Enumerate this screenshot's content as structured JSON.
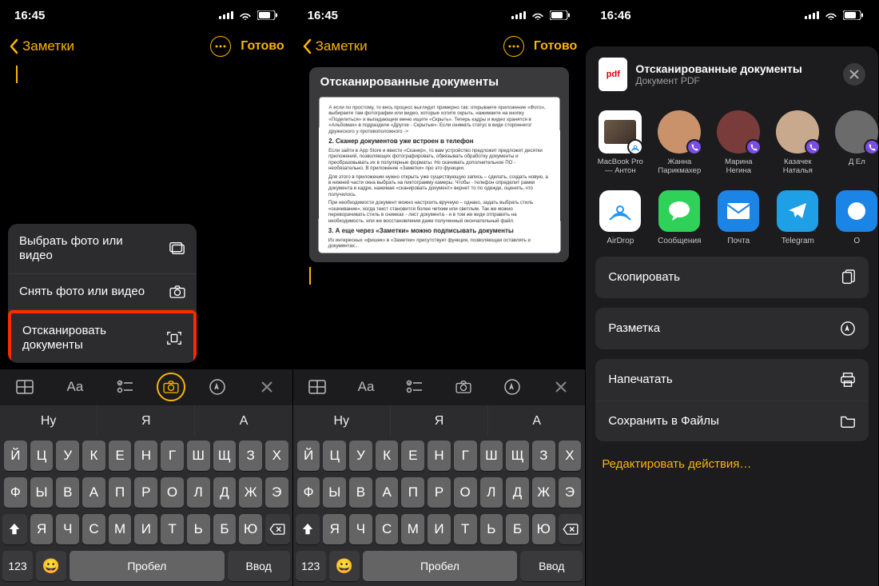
{
  "screen1": {
    "time": "16:45",
    "back": "Заметки",
    "done": "Готово",
    "menu": {
      "choose": "Выбрать фото или видео",
      "take": "Снять фото или видео",
      "scan": "Отсканировать документы"
    },
    "toolbar_labels": {
      "Aa": "Aa"
    },
    "suggestions": [
      "Ну",
      "Я",
      "А"
    ],
    "keys_row1": [
      "Й",
      "Ц",
      "У",
      "К",
      "Е",
      "Н",
      "Г",
      "Ш",
      "Щ",
      "З",
      "Х"
    ],
    "keys_row2": [
      "Ф",
      "Ы",
      "В",
      "А",
      "П",
      "Р",
      "О",
      "Л",
      "Д",
      "Ж",
      "Э"
    ],
    "keys_row3": [
      "Я",
      "Ч",
      "С",
      "М",
      "И",
      "Т",
      "Ь",
      "Б",
      "Ю"
    ],
    "k123": "123",
    "space": "Пробел",
    "enter": "Ввод"
  },
  "screen2": {
    "time": "16:45",
    "back": "Заметки",
    "done": "Готово",
    "attachment_title": "Отсканированные документы",
    "scan_text": {
      "p1": "А если по простому, то весь процесс выглядит примерно так: открываете приложение «Фото», выбираете там фотографии или видео, которые хотите скрыть, нажимаете на кнопку «Поделиться» и выпадающем меню ищите «Скрыть». Теперь кадры и видео хранятся в «Альбомах» в подразделе «Другое - Скрытые». Если снимать статус в виде стороннего/дружеского у противоположного ->",
      "h1": "2. Сканер документов уже встроен в телефон",
      "p2": "Если зайти в App Store и ввести «Сканер», то вам устройство предложит предложит десятки приложений, позволяющих фотографировать, обвязывать обработку документы и преобразовывать их в популярные форматы. Но скачивать дополнительное ПО - необязательно. В приложение «Заметки» про это функции.",
      "p3": "Для этого в приложении нужно открыть уже существующую запись – сделать, создать новую, а в нижней части окна выбрать на пиктограмму камеры. Чтобы - телефон определит рамки документа в кадре, нажимая «сканировать документ» вернет то по одежде, оценить, что получилось.",
      "p4": "При необходимости документ можно настроить вручную – однако, задать выбрать стиль «скачивание», когда текст становится более четким или светлым. Так же можно переворачивать стиль в снимках - лист документа - и в том же виде отправить на необходимость. или же восстановления даже полученный окончательный файл.",
      "h2": "3. А еще через «Заметки» можно подписывать документы",
      "p5": "Из интересных «фишек» в «Заметки» присутствует функция, позволяющая оставлять и документах..."
    },
    "toolbar_labels": {
      "Aa": "Aa"
    },
    "suggestions": [
      "Ну",
      "Я",
      "А"
    ],
    "keys_row1": [
      "Й",
      "Ц",
      "У",
      "К",
      "Е",
      "Н",
      "Г",
      "Ш",
      "Щ",
      "З",
      "Х"
    ],
    "keys_row2": [
      "Ф",
      "Ы",
      "В",
      "А",
      "П",
      "Р",
      "О",
      "Л",
      "Д",
      "Ж",
      "Э"
    ],
    "keys_row3": [
      "Я",
      "Ч",
      "С",
      "М",
      "И",
      "Т",
      "Ь",
      "Б",
      "Ю"
    ],
    "k123": "123",
    "space": "Пробел",
    "enter": "Ввод"
  },
  "screen3": {
    "time": "16:46",
    "pdf_badge": "pdf",
    "title": "Отсканированные документы",
    "subtitle": "Документ PDF",
    "contacts": [
      {
        "name": "MacBook Pro — Антон",
        "badge": "airdrop",
        "bg": "#5a5751"
      },
      {
        "name": "Жанна Парикмахер",
        "badge": "viber",
        "bg": "#c9926b"
      },
      {
        "name": "Марина Негина",
        "badge": "viber",
        "bg": "#7a3b3b"
      },
      {
        "name": "Казачек Наталья",
        "badge": "viber",
        "bg": "#c8a98e"
      },
      {
        "name": "Д Ел",
        "badge": "viber",
        "bg": "#6b6b6b"
      }
    ],
    "apps": [
      {
        "name": "AirDrop",
        "bg": "#ffffff",
        "type": "airdrop"
      },
      {
        "name": "Сообщения",
        "bg": "#30d158",
        "type": "msg"
      },
      {
        "name": "Почта",
        "bg": "#1b84e7",
        "type": "mail"
      },
      {
        "name": "Telegram",
        "bg": "#1e9fe6",
        "type": "tg"
      },
      {
        "name": "О",
        "bg": "#1b84e7",
        "type": "other"
      }
    ],
    "actions": [
      {
        "label": "Скопировать",
        "icon": "copy"
      },
      {
        "label": "Разметка",
        "icon": "markup"
      },
      {
        "label": "Напечатать",
        "icon": "print"
      },
      {
        "label": "Сохранить в Файлы",
        "icon": "files"
      }
    ],
    "edit_actions": "Редактировать действия…"
  }
}
